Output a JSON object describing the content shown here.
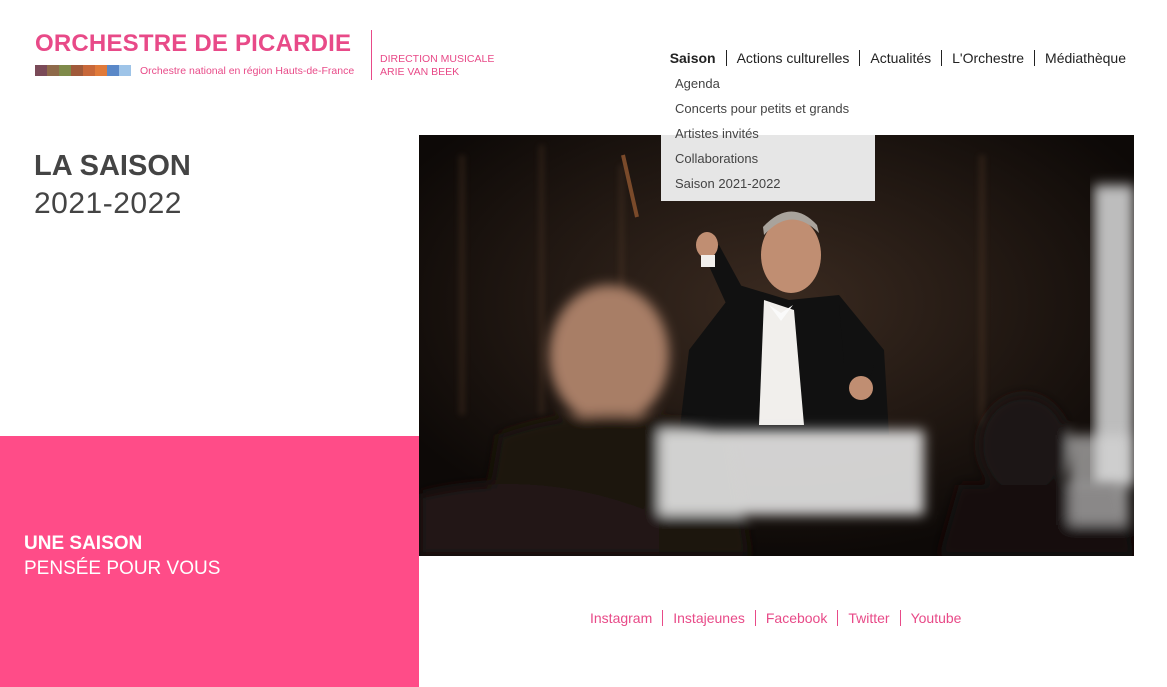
{
  "logo": {
    "title": "ORCHESTRE DE PICARDIE",
    "subtitle": "Orchestre national en région Hauts-de-France",
    "direction_label": "DIRECTION MUSICALE",
    "director_name": "ARIE VAN BEEK",
    "strip_colors": [
      "#7a4a58",
      "#8e6a4a",
      "#7f8a4a",
      "#a05a3a",
      "#c8683a",
      "#e07a3a",
      "#5a88c8",
      "#9ec4e8"
    ]
  },
  "nav": {
    "items": [
      {
        "label": "Saison",
        "active": true
      },
      {
        "label": "Actions culturelles"
      },
      {
        "label": "Actualités"
      },
      {
        "label": "L'Orchestre"
      },
      {
        "label": "Médiathèque"
      }
    ]
  },
  "dropdown": {
    "items": [
      "Agenda",
      "Concerts pour petits et grands",
      "Artistes invités",
      "Collaborations",
      "Saison 2021-2022"
    ]
  },
  "heading": {
    "title": "LA SAISON",
    "years": "2021-2022"
  },
  "promo": {
    "line1": "UNE SAISON",
    "line2": "PENSÉE POUR VOUS",
    "color": "#ff4c88"
  },
  "photo": {
    "description_icon": "conductor-photo"
  },
  "social": {
    "items": [
      "Instagram",
      "Instajeunes",
      "Facebook",
      "Twitter",
      "Youtube"
    ],
    "color": "#e84a88"
  }
}
